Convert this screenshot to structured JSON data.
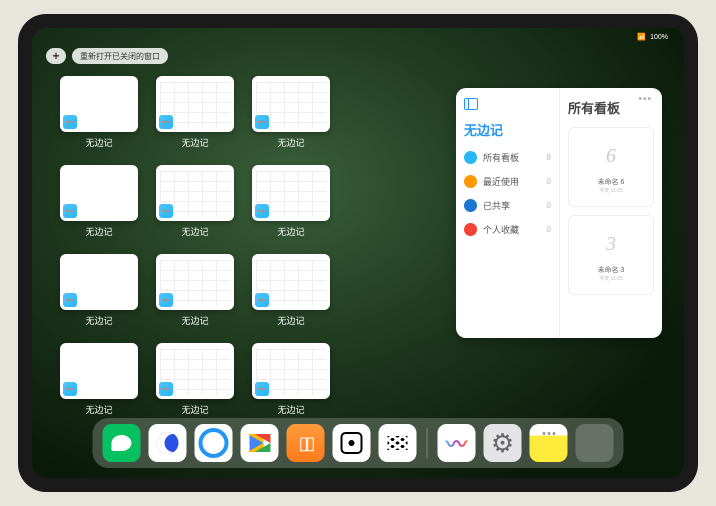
{
  "status": {
    "time": "",
    "battery": "100%"
  },
  "topbar": {
    "plus": "+",
    "reopen_label": "重新打开已关闭的窗口"
  },
  "app_label": "无边记",
  "windows": [
    {
      "type": "blank"
    },
    {
      "type": "grid"
    },
    {
      "type": "grid"
    },
    {
      "type": "blank"
    },
    {
      "type": "grid"
    },
    {
      "type": "grid"
    },
    {
      "type": "blank"
    },
    {
      "type": "grid"
    },
    {
      "type": "grid"
    },
    {
      "type": "blank"
    },
    {
      "type": "grid"
    },
    {
      "type": "grid"
    }
  ],
  "panel": {
    "left_title": "无边记",
    "right_title": "所有看板",
    "categories": [
      {
        "label": "所有看板",
        "count": 8,
        "color": "blue"
      },
      {
        "label": "最近使用",
        "count": 0,
        "color": "orange"
      },
      {
        "label": "已共享",
        "count": 0,
        "color": "dblue"
      },
      {
        "label": "个人收藏",
        "count": 0,
        "color": "red"
      }
    ],
    "boards": [
      {
        "sketch": "6",
        "name": "未命名 6",
        "date": "今天 11:25"
      },
      {
        "sketch": "3",
        "name": "未命名 3",
        "date": "今天 11:25"
      }
    ]
  },
  "dock": {
    "apps": [
      "wechat",
      "qq1",
      "qq2",
      "play",
      "books",
      "dice",
      "dots",
      "freeform",
      "settings",
      "notes"
    ],
    "recent_grid_colors": [
      "#5ac8fa",
      "#ffcc00",
      "#34c759",
      "#007aff"
    ]
  }
}
